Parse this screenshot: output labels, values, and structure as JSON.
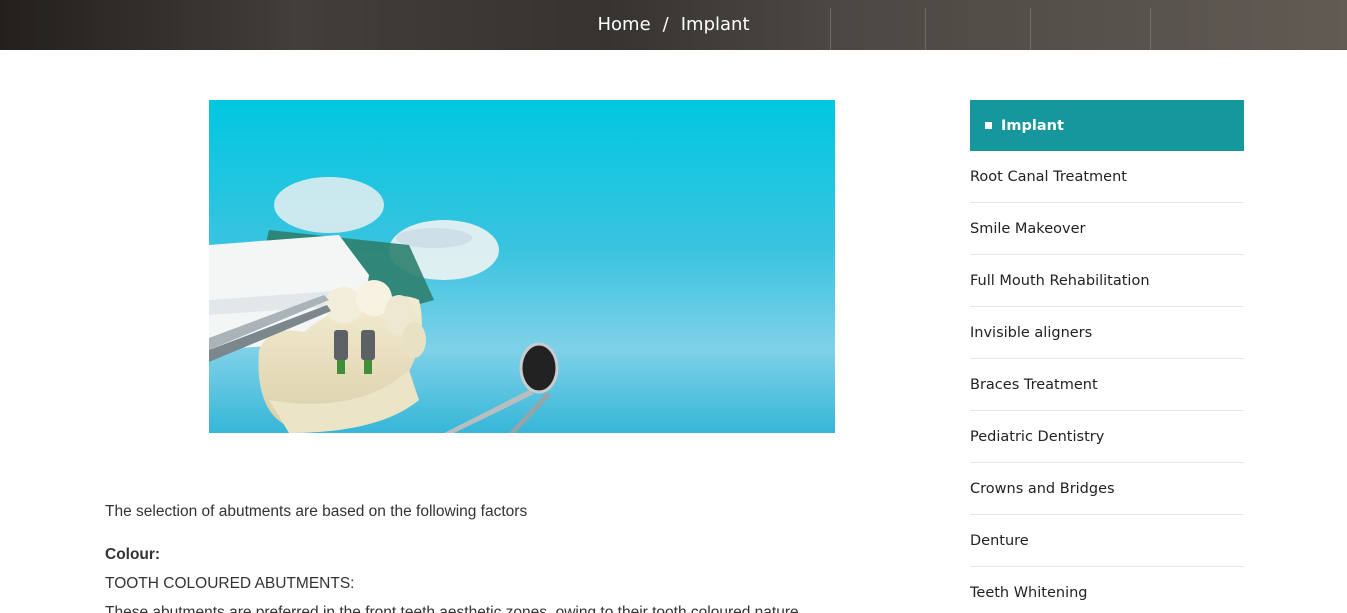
{
  "breadcrumb": {
    "home": "Home",
    "separator": "/",
    "current": "Implant"
  },
  "hero": {
    "image": "dental-implant-model-photo"
  },
  "content": {
    "intro": "The selection of abutments are based on the following factors",
    "heading": "Colour:",
    "subheading": "TOOTH COLOURED ABUTMENTS:",
    "body": "These abutments are preferred in the front teeth aesthetic zones, owing to their tooth coloured nature."
  },
  "sidebar": {
    "items": [
      {
        "label": "Implant",
        "active": true
      },
      {
        "label": "Root Canal Treatment"
      },
      {
        "label": "Smile Makeover"
      },
      {
        "label": "Full Mouth Rehabilitation"
      },
      {
        "label": "Invisible aligners"
      },
      {
        "label": "Braces Treatment"
      },
      {
        "label": "Pediatric Dentistry"
      },
      {
        "label": "Crowns and Bridges"
      },
      {
        "label": "Denture"
      },
      {
        "label": "Teeth Whitening"
      }
    ]
  },
  "colors": {
    "accent": "#16979d",
    "hero_bg": "#00c6df"
  }
}
